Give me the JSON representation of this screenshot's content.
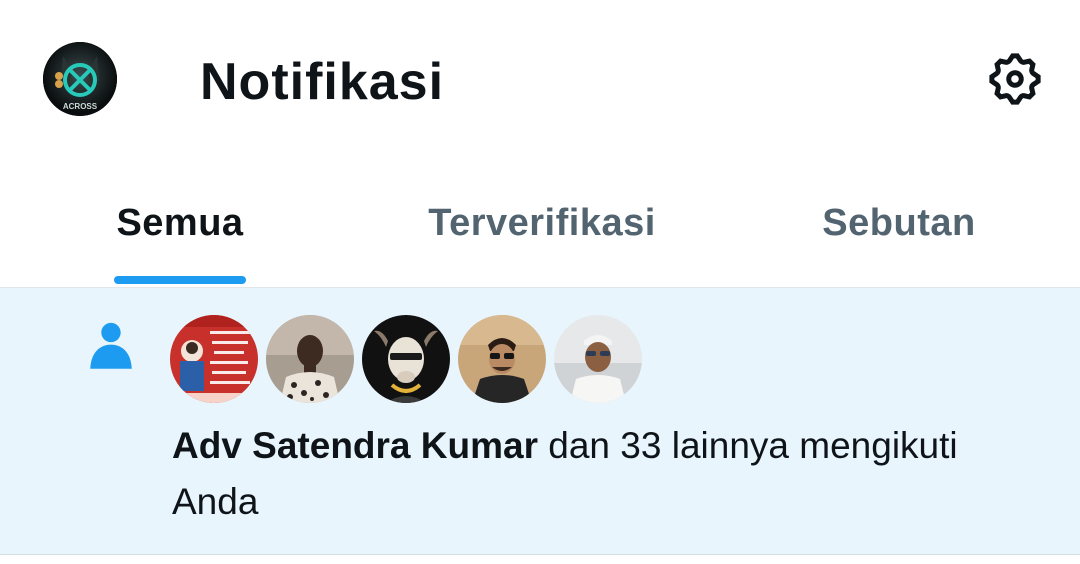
{
  "header": {
    "title": "Notifikasi",
    "profile_avatar_text": "ACROSS",
    "settings_icon": "gear-icon"
  },
  "tabs": [
    {
      "label": "Semua",
      "active": true
    },
    {
      "label": "Terverifikasi",
      "active": false
    },
    {
      "label": "Sebutan",
      "active": false
    }
  ],
  "colors": {
    "accent": "#1d9bf0",
    "notification_bg": "#e8f5fd",
    "text_primary": "#0f1419",
    "text_secondary": "#536471"
  },
  "notification": {
    "type_icon": "person-icon",
    "avatar_count": 5,
    "actor_name": "Adv Satendra Kumar",
    "message_rest": " dan 33 lainnya mengikuti Anda"
  }
}
